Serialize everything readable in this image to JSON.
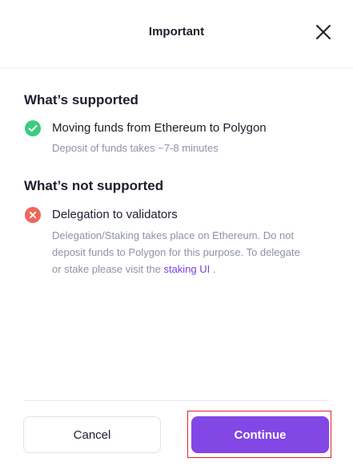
{
  "dialog": {
    "title": "Important"
  },
  "supported": {
    "heading": "What’s supported",
    "item_title": "Moving funds from Ethereum to Polygon",
    "item_desc": "Deposit of funds takes ~7-8 minutes"
  },
  "not_supported": {
    "heading": "What’s not supported",
    "item_title": "Delegation to validators",
    "desc_line1": "Delegation/Staking takes place on Ethereum. Do not",
    "desc_line2": "deposit funds to Polygon for this purpose. To delegate",
    "desc_line3_prefix": "or stake please visit the ",
    "link_text": "staking UI",
    "desc_line3_suffix": " ."
  },
  "buttons": {
    "cancel_label": "Cancel",
    "continue_label": "Continue"
  },
  "colors": {
    "accent": "#8247e5",
    "success": "#3ccb7f",
    "error": "#f1665a",
    "link": "#7b3fe4",
    "highlight": "#e0242e"
  },
  "icons": {
    "close": "close-icon",
    "supported": "check-circle-icon",
    "not_supported": "x-circle-icon"
  }
}
